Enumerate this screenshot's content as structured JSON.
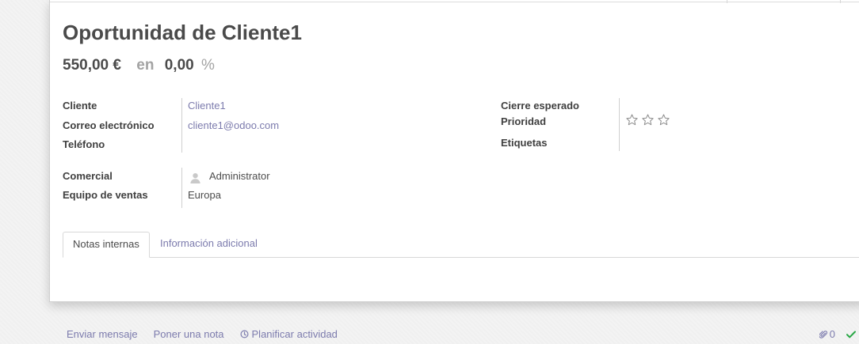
{
  "record": {
    "title": "Oportunidad de Cliente1",
    "expected_revenue": "550,00 €",
    "at_label": "en",
    "probability": "0,00",
    "probability_unit": "%"
  },
  "fields_left": {
    "customer_label": "Cliente",
    "customer_value": "Cliente1",
    "email_label": "Correo electrónico",
    "email_value": "cliente1@odoo.com",
    "phone_label": "Teléfono",
    "phone_value": ""
  },
  "fields_right": {
    "expected_closing_label": "Cierre esperado",
    "expected_closing_value": "",
    "priority_label": "Prioridad",
    "priority_stars": 0,
    "priority_max": 3,
    "tags_label": "Etiquetas"
  },
  "sales": {
    "salesperson_label": "Comercial",
    "salesperson_value": "Administrator",
    "team_label": "Equipo de ventas",
    "team_value": "Europa"
  },
  "tabs": [
    {
      "label": "Notas internas",
      "active": true
    },
    {
      "label": "Información adicional",
      "active": false
    }
  ],
  "chatter": {
    "send_message": "Enviar mensaje",
    "log_note": "Poner una nota",
    "schedule_activity": "Planificar actividad",
    "attachments_count": "0"
  },
  "colors": {
    "link": "#7c7bad",
    "follow": "#28a745"
  }
}
